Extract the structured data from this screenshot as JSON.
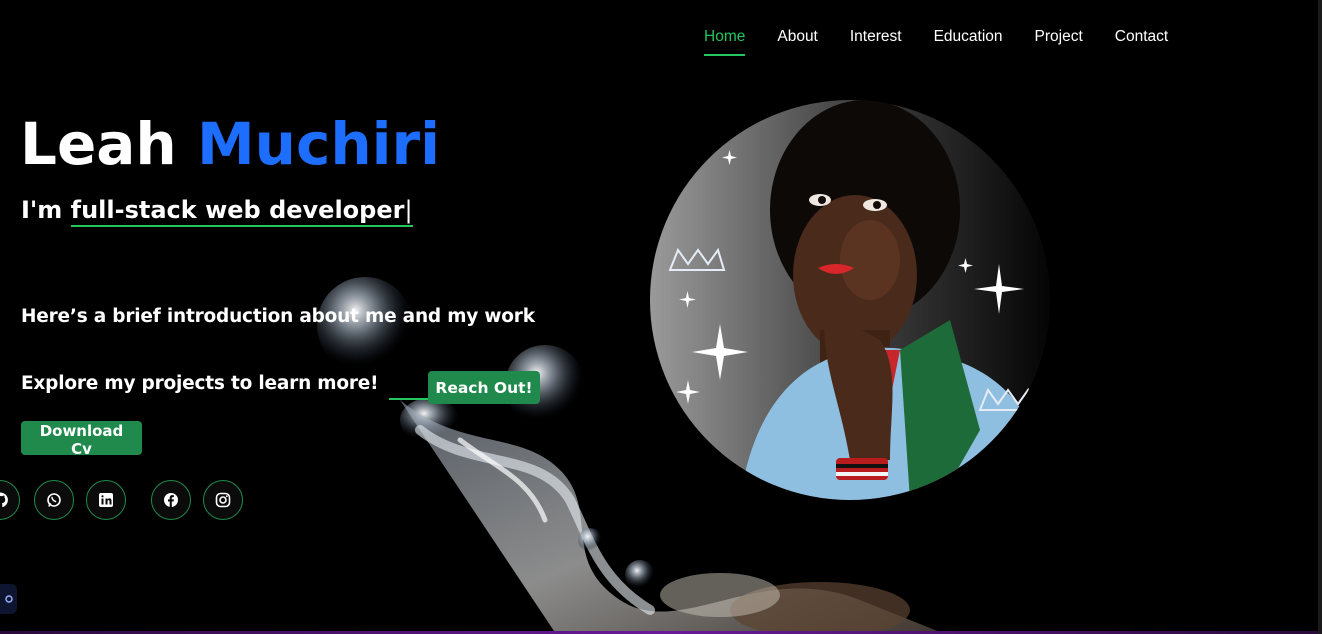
{
  "nav": {
    "items": [
      {
        "label": "Home",
        "active": true
      },
      {
        "label": "About"
      },
      {
        "label": "Interest"
      },
      {
        "label": "Education"
      },
      {
        "label": "Project"
      },
      {
        "label": "Contact"
      }
    ]
  },
  "hero": {
    "first_name": "Leah",
    "last_name": "Muchiri",
    "role_prefix": "I'm",
    "role_typed": "full-stack web developer",
    "caret": "|",
    "intro": "Here’s a brief introduction about me and my work",
    "explore": "Explore my projects to learn more!",
    "reach_label": "Reach Out!",
    "download_label": "Download Cv"
  },
  "socials": [
    "github-icon",
    "whatsapp-icon",
    "linkedin-icon",
    "facebook-icon",
    "instagram-icon"
  ],
  "colors": {
    "accent_green": "#22c55e",
    "button_green": "#1f8a4c",
    "name_blue": "#1d6dff",
    "background": "#000000"
  }
}
